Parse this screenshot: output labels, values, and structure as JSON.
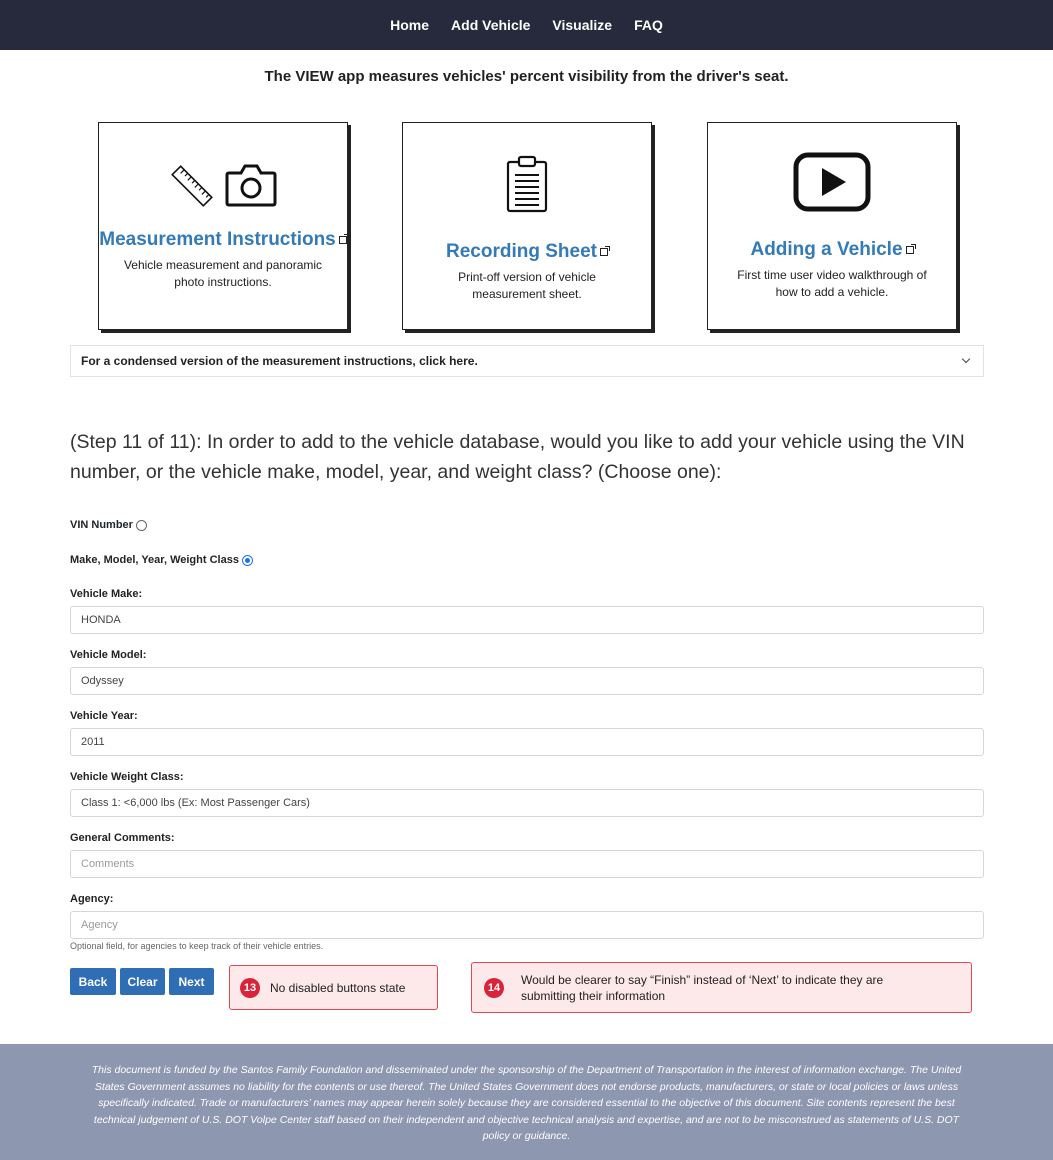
{
  "nav": {
    "items": [
      "Home",
      "Add Vehicle",
      "Visualize",
      "FAQ"
    ]
  },
  "tagline": "The VIEW app measures vehicles' percent visibility from the driver's seat.",
  "cards": [
    {
      "title": "Measurement Instructions",
      "desc": "Vehicle measurement and panoramic photo instructions.",
      "icons": [
        "ruler-icon",
        "camera-icon"
      ]
    },
    {
      "title": "Recording Sheet",
      "desc": "Print-off version of vehicle measurement sheet.",
      "icons": [
        "clipboard-icon"
      ]
    },
    {
      "title": "Adding a Vehicle",
      "desc": "First time user video walkthrough of how to add a vehicle.",
      "icons": [
        "play-video-icon"
      ]
    }
  ],
  "accordion": {
    "text": "For a condensed version of the measurement instructions, click here."
  },
  "step_question": "(Step 11 of 11): In order to add to the vehicle database, would you like to add your vehicle using the VIN number, or the vehicle make, model, year, and weight class? (Choose one):",
  "options": {
    "vin": {
      "label": "VIN Number",
      "checked": false
    },
    "mmyw": {
      "label": "Make, Model, Year, Weight Class",
      "checked": true
    }
  },
  "form": {
    "make": {
      "label": "Vehicle Make:",
      "value": "HONDA"
    },
    "model": {
      "label": "Vehicle Model:",
      "value": "Odyssey"
    },
    "year": {
      "label": "Vehicle Year:",
      "value": "2011"
    },
    "weight_class": {
      "label": "Vehicle Weight Class:",
      "value": "Class 1: <6,000 lbs (Ex: Most Passenger Cars)"
    },
    "comments": {
      "label": "General Comments:",
      "placeholder": "Comments"
    },
    "agency": {
      "label": "Agency:",
      "placeholder": "Agency",
      "help": "Optional field, for agencies to keep track of their vehicle entries."
    }
  },
  "buttons": {
    "back": "Back",
    "clear": "Clear",
    "next": "Next"
  },
  "annotations": [
    {
      "num": "13",
      "text": "No disabled buttons state"
    },
    {
      "num": "14",
      "text": "Would be clearer to say “Finish” instead of ‘Next’ to indicate they are submitting their information"
    }
  ],
  "footer": "This document is funded by the Santos Family Foundation and disseminated under the sponsorship of the Department of Transportation in the interest of information exchange. The United States Government assumes no liability for the contents or use thereof. The United States Government does not endorse products, manufacturers, or state or local policies or laws unless specifically indicated. Trade or manufacturers’ names may appear herein solely because they are considered essential to the objective of this document. Site contents represent the best technical judgement of U.S. DOT Volpe Center staff based on their independent and objective technical analysis and expertise, and are not to be misconstrued as statements of U.S. DOT policy or guidance.",
  "colors": {
    "nav_bg": "#262a3c",
    "link": "#337ab7",
    "button": "#2f6db4",
    "footer_bg": "#8e97b0",
    "annotation_border": "#e04857",
    "annotation_badge": "#d8243a"
  }
}
